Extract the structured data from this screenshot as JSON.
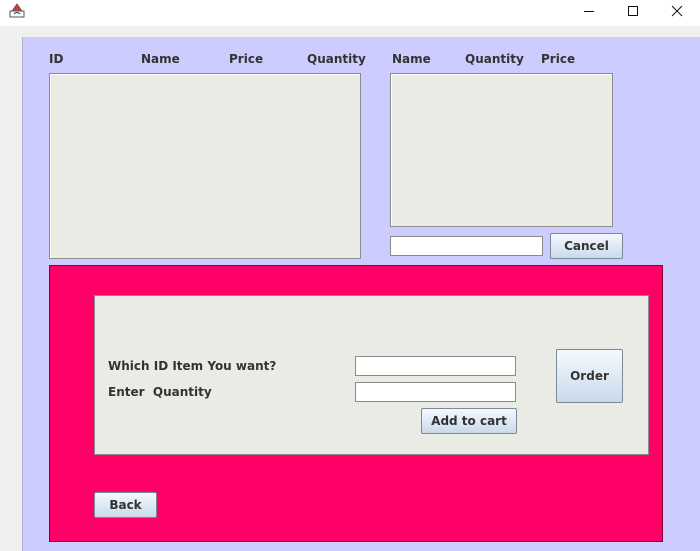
{
  "window": {
    "minimize_icon": "minimize-icon",
    "maximize_icon": "maximize-icon",
    "close_icon": "close-icon"
  },
  "menu_table": {
    "headers": [
      "ID",
      "Name",
      "Price",
      "Quantity"
    ]
  },
  "cart_table": {
    "headers": [
      "Name",
      "Quantity",
      "Price"
    ],
    "cancel_input_value": "",
    "cancel_label": "Cancel"
  },
  "order_panel": {
    "item_id_label": "Which ID Item You want?",
    "item_id_value": "",
    "quantity_label": "Enter  Quantity",
    "quantity_value": "",
    "add_to_cart_label": "Add to cart",
    "order_label": "Order"
  },
  "back_label": "Back",
  "colors": {
    "content_bg": "#ccccff",
    "order_panel_bg": "#ff0066",
    "list_bg": "#ebebe5"
  }
}
